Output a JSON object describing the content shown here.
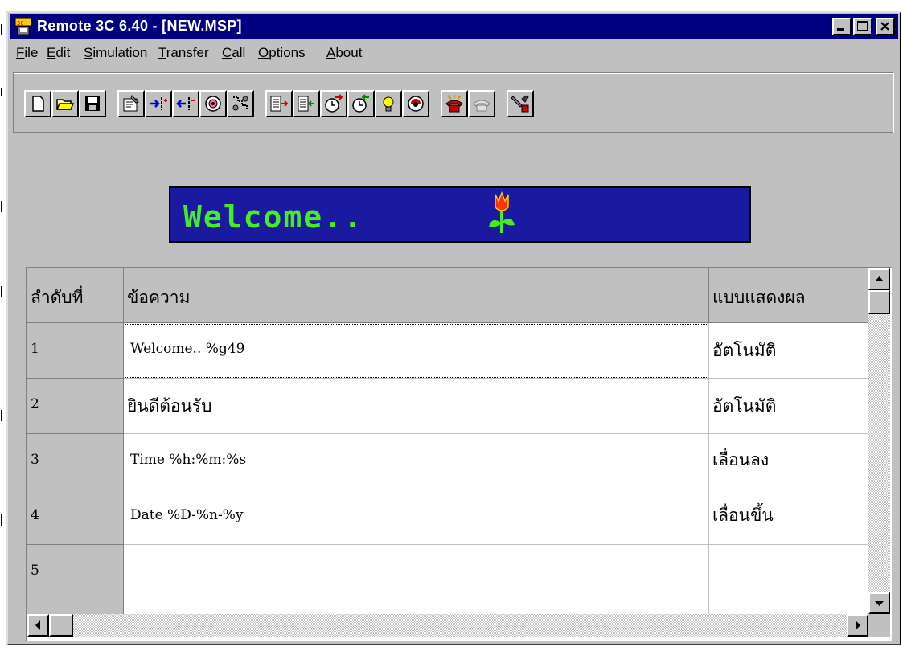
{
  "window": {
    "title": "Remote 3C 6.40 - [NEW.MSP]"
  },
  "menu": [
    {
      "label": "File",
      "accel": "F",
      "rest": "ile"
    },
    {
      "label": "Edit",
      "accel": "E",
      "rest": "dit"
    },
    {
      "label": "Simulation",
      "accel": "S",
      "rest": "imulation"
    },
    {
      "label": "Transfer",
      "accel": "T",
      "rest": "ransfer"
    },
    {
      "label": "Call",
      "accel": "C",
      "rest": "all"
    },
    {
      "label": "Options",
      "accel": "O",
      "rest": "ptions"
    },
    {
      "label": "About",
      "accel": "A",
      "rest": "bout"
    }
  ],
  "toolbar": {
    "icons": [
      "new-icon",
      "open-folder-icon",
      "save-icon",
      "properties-icon",
      "insert-row-icon",
      "delete-row-icon",
      "preview-icon",
      "connect-icon",
      "send-file-icon",
      "receive-file-icon",
      "set-time-icon",
      "get-time-icon",
      "brightness-icon",
      "monitor-icon",
      "dial-icon",
      "hangup-icon",
      "settings-icon"
    ]
  },
  "banner": {
    "text": "Welcome.."
  },
  "table": {
    "headers": {
      "index": "ลำดับที่",
      "message": "ข้อความ",
      "display_mode": "แบบแสดงผล"
    },
    "rows": [
      {
        "index": "1",
        "message": "Welcome.. %g49",
        "display_mode": "อัตโนมัติ"
      },
      {
        "index": "2",
        "message": "ยินดีต้อนรับ",
        "display_mode": "อัตโนมัติ"
      },
      {
        "index": "3",
        "message": "Time %h:%m:%s",
        "display_mode": "เลื่อนลง"
      },
      {
        "index": "4",
        "message": "Date %D-%n-%y",
        "display_mode": "เลื่อนขึ้น"
      },
      {
        "index": "5",
        "message": "",
        "display_mode": ""
      },
      {
        "index": "",
        "message": "",
        "display_mode": ""
      }
    ]
  },
  "colors": {
    "titlebar": "#000080",
    "face": "#c0c0c0",
    "banner_bg": "#1a1aa0",
    "banner_text": "#44ee22"
  }
}
